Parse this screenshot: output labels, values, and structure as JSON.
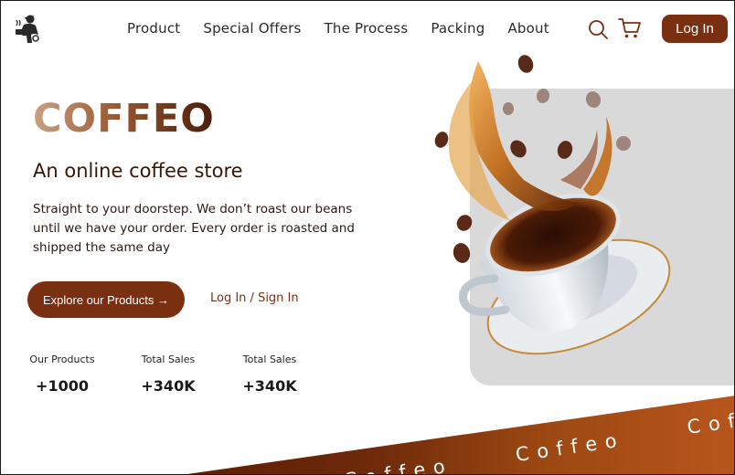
{
  "nav": {
    "items": [
      "Product",
      "Special Offers",
      "The Process",
      "Packing",
      "About"
    ],
    "login_label": "Log In"
  },
  "hero": {
    "brand": "COFFEO",
    "subtitle": "An online coffee store",
    "description": "Straight to your doorstep. We don’t roast our beans until we have your order. Every order is roasted and shipped the same day",
    "explore_label": "Explore our Products →",
    "signin_label": "Log In / Sign In"
  },
  "stats": [
    {
      "label": "Our Products",
      "value": "+1000"
    },
    {
      "label": "Total Sales",
      "value": "+340K"
    },
    {
      "label": "Total Sales",
      "value": "+340K"
    }
  ],
  "banner": {
    "words": [
      "C o f f e o",
      "C o f f e o",
      "C o f"
    ]
  },
  "colors": {
    "accent": "#7a3010",
    "panel": "#d9d9d9",
    "banner_dark": "#5a1e06",
    "banner_light": "#b8561c"
  },
  "icons": [
    "logo-icon",
    "search-icon",
    "cart-icon"
  ]
}
